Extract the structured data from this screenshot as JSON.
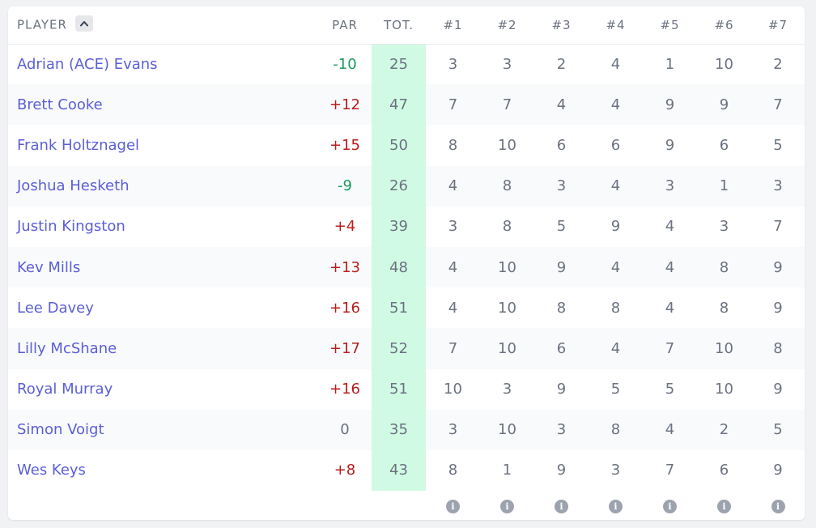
{
  "header": {
    "player": "PLAYER",
    "par": "PAR",
    "total": "TOT.",
    "holes": [
      "#1",
      "#2",
      "#3",
      "#4",
      "#5",
      "#6",
      "#7"
    ]
  },
  "icons": {
    "sort": "chevron-up-icon",
    "info": "info-icon"
  },
  "colors": {
    "link": "#5b5fd6",
    "under_par": "#1a9a5c",
    "over_par": "#b91c1c",
    "total_highlight": "#d1fae5"
  },
  "rows": [
    {
      "name": "Adrian (ACE) Evans",
      "par": "-10",
      "total": "25",
      "holes": [
        "3",
        "3",
        "2",
        "4",
        "1",
        "10",
        "2"
      ]
    },
    {
      "name": "Brett Cooke",
      "par": "+12",
      "total": "47",
      "holes": [
        "7",
        "7",
        "4",
        "4",
        "9",
        "9",
        "7"
      ]
    },
    {
      "name": "Frank Holtznagel",
      "par": "+15",
      "total": "50",
      "holes": [
        "8",
        "10",
        "6",
        "6",
        "9",
        "6",
        "5"
      ]
    },
    {
      "name": "Joshua Hesketh",
      "par": "-9",
      "total": "26",
      "holes": [
        "4",
        "8",
        "3",
        "4",
        "3",
        "1",
        "3"
      ]
    },
    {
      "name": "Justin Kingston",
      "par": "+4",
      "total": "39",
      "holes": [
        "3",
        "8",
        "5",
        "9",
        "4",
        "3",
        "7"
      ]
    },
    {
      "name": "Kev Mills",
      "par": "+13",
      "total": "48",
      "holes": [
        "4",
        "10",
        "9",
        "4",
        "4",
        "8",
        "9"
      ]
    },
    {
      "name": "Lee Davey",
      "par": "+16",
      "total": "51",
      "holes": [
        "4",
        "10",
        "8",
        "8",
        "4",
        "8",
        "9"
      ]
    },
    {
      "name": "Lilly McShane",
      "par": "+17",
      "total": "52",
      "holes": [
        "7",
        "10",
        "6",
        "4",
        "7",
        "10",
        "8"
      ]
    },
    {
      "name": "Royal Murray",
      "par": "+16",
      "total": "51",
      "holes": [
        "10",
        "3",
        "9",
        "5",
        "5",
        "10",
        "9"
      ]
    },
    {
      "name": "Simon Voigt",
      "par": "0",
      "total": "35",
      "holes": [
        "3",
        "10",
        "3",
        "8",
        "4",
        "2",
        "5"
      ]
    },
    {
      "name": "Wes Keys",
      "par": "+8",
      "total": "43",
      "holes": [
        "8",
        "1",
        "9",
        "3",
        "7",
        "6",
        "9"
      ]
    }
  ]
}
